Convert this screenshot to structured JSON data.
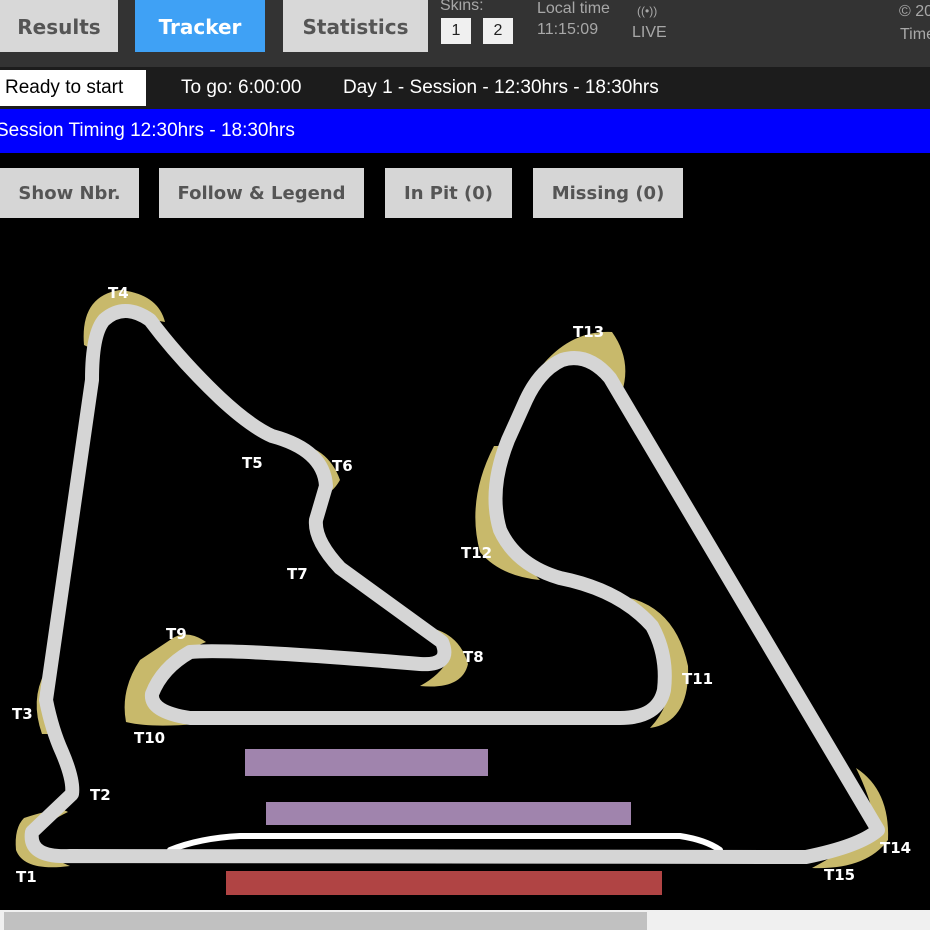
{
  "nav": {
    "tabs": [
      {
        "label": "Results",
        "active": false
      },
      {
        "label": "Tracker",
        "active": true
      },
      {
        "label": "Statistics",
        "active": false
      }
    ],
    "skins_label": "Skins:",
    "skins": [
      "1",
      "2"
    ],
    "local_time_label": "Local time",
    "local_time": "11:15:09",
    "live_icon": "broadcast-icon",
    "live_symbol": "((•))",
    "live_label": "LIVE",
    "copyright_line1": "© 20",
    "copyright_line2": "Time"
  },
  "status": {
    "state": "Ready to start",
    "to_go": "To go: 6:00:00",
    "session": "Day 1 - Session - 12:30hrs - 18:30hrs"
  },
  "banner": {
    "text": "Session Timing 12:30hrs - 18:30hrs",
    "color": "#0000ff"
  },
  "controls": {
    "show_nbr": "Show Nbr.",
    "follow_legend": "Follow & Legend",
    "in_pit": "In Pit (0)",
    "missing": "Missing (0)"
  },
  "track": {
    "turns": [
      "T1",
      "T2",
      "T3",
      "T4",
      "T5",
      "T6",
      "T7",
      "T8",
      "T9",
      "T10",
      "T11",
      "T12",
      "T13",
      "T14",
      "T15"
    ],
    "colors": {
      "track": "#d5d5d5",
      "kerb": "#c8b96b",
      "pit_lane": "#ffffff",
      "marker_purple": "#a084ad",
      "marker_red": "#b04444"
    }
  }
}
